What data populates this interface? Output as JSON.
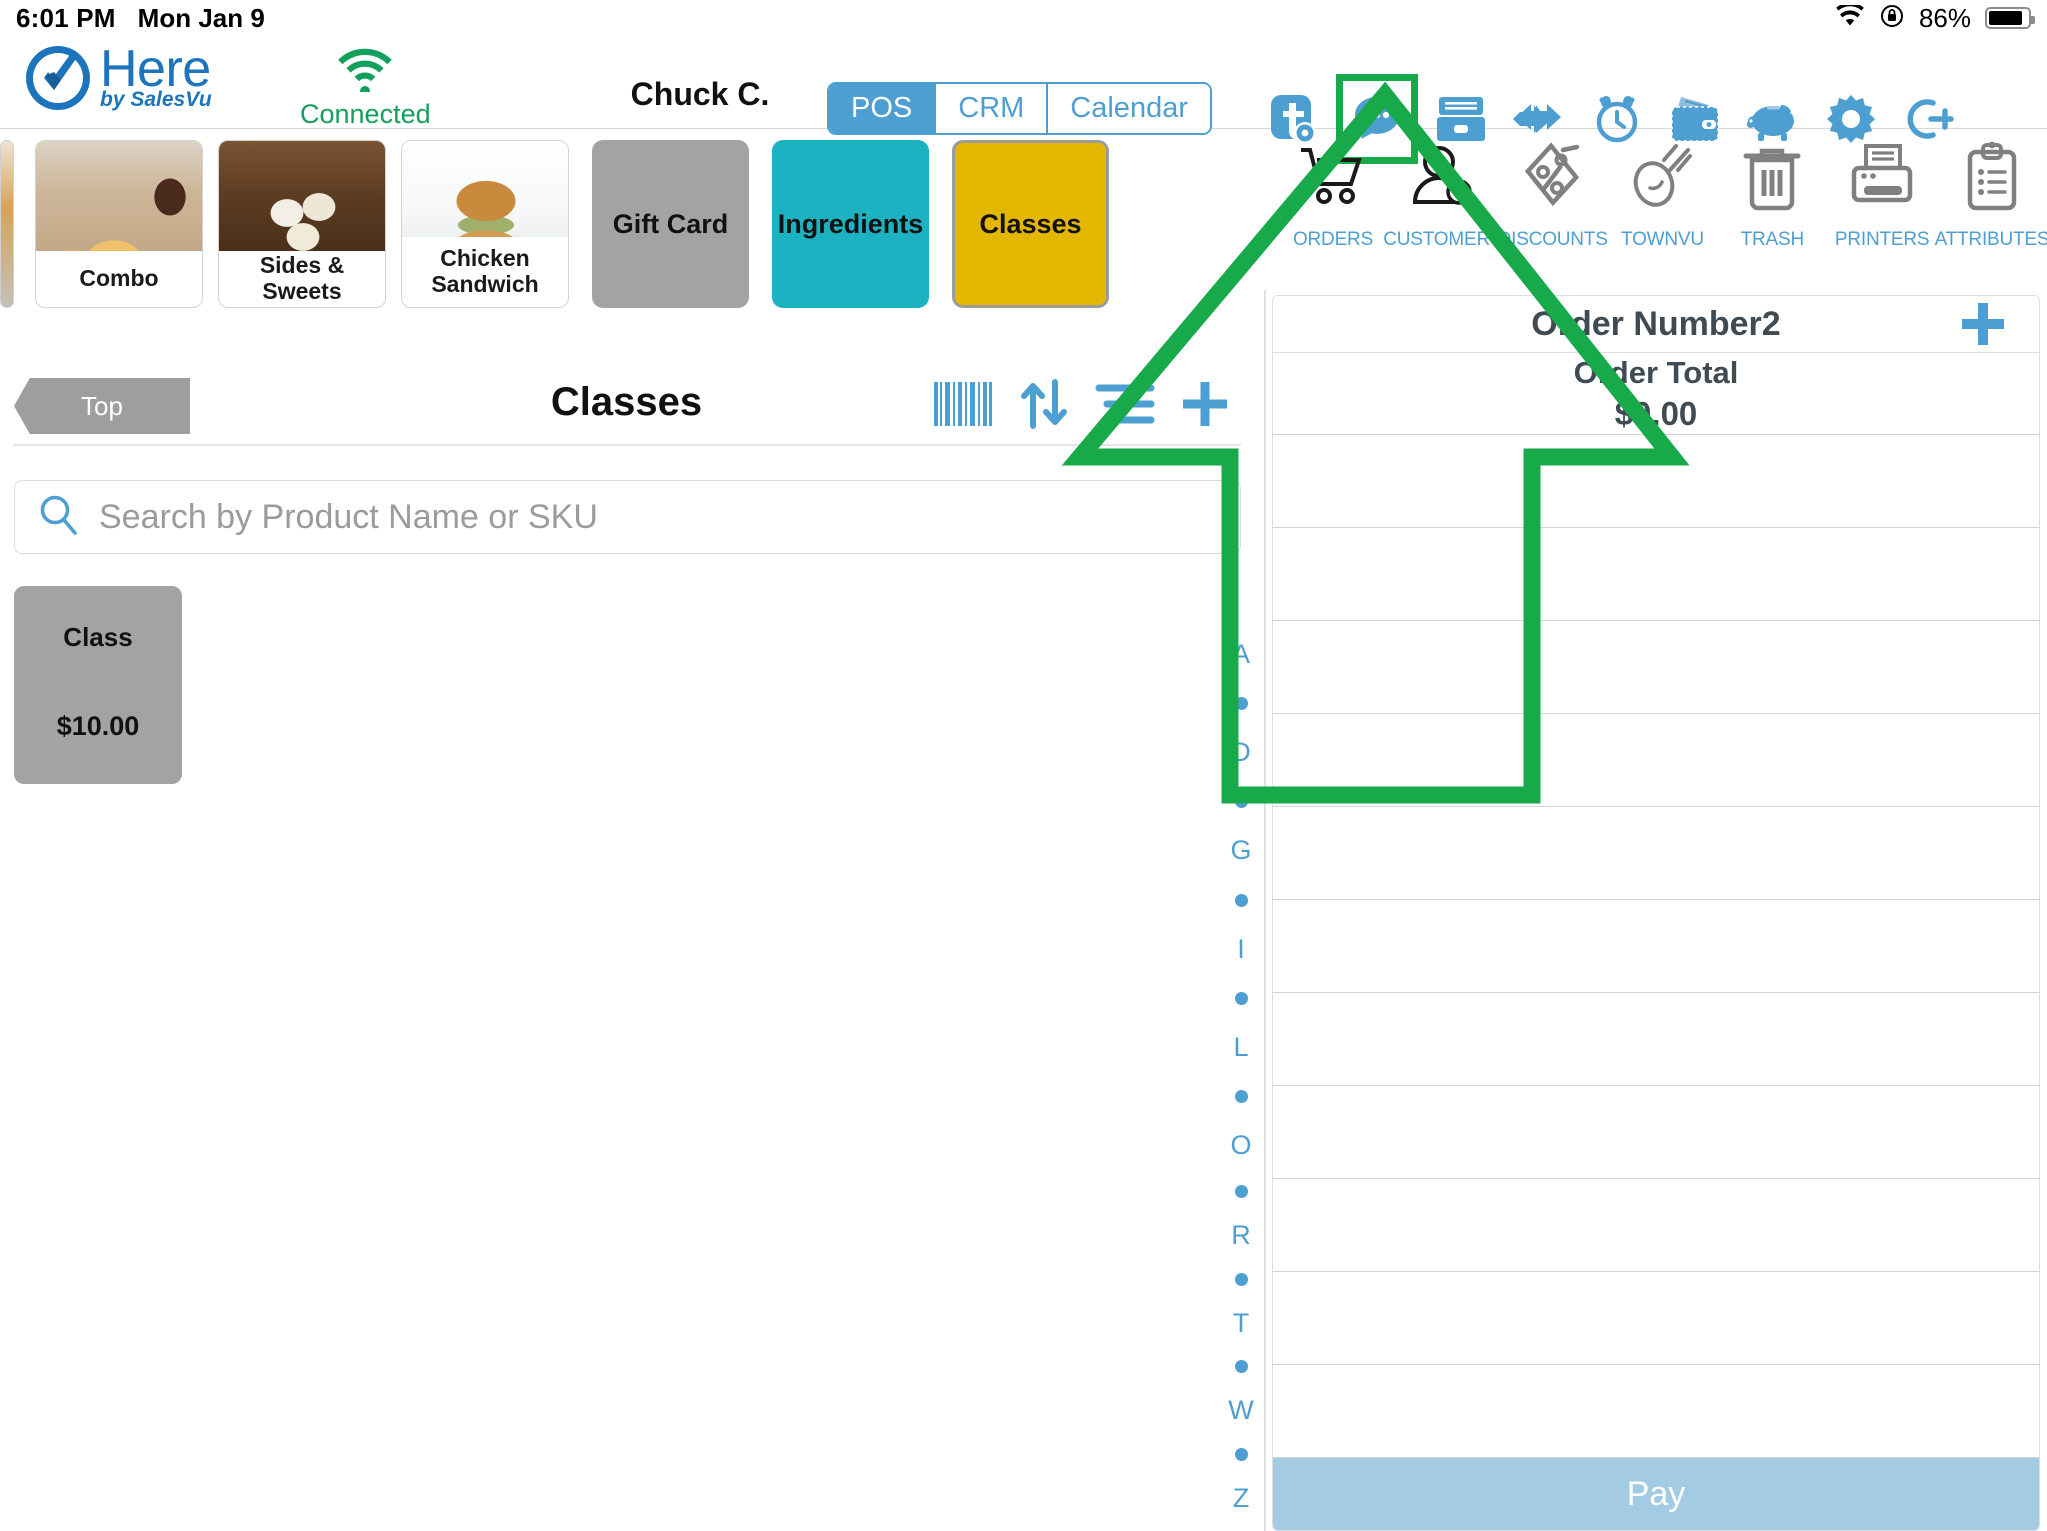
{
  "status_bar": {
    "time": "6:01 PM",
    "date": "Mon Jan 9",
    "wifi_icon": "wifi-icon",
    "orientation_lock_icon": "rotation-lock-icon",
    "battery_percent": "86%",
    "battery_icon": "battery-icon"
  },
  "header": {
    "logo_name": "Here",
    "logo_tagline": "by SalesVu",
    "logo_icon": "here-checkmark-logo",
    "connection": {
      "icon": "wifi-signal-icon",
      "label": "Connected",
      "color": "#13a05c"
    },
    "user_name": "Chuck C.",
    "segments": [
      {
        "label": "POS",
        "active": true
      },
      {
        "label": "CRM",
        "active": false
      },
      {
        "label": "Calendar",
        "active": false
      }
    ],
    "tool_icons": [
      {
        "name": "townvu-settings-icon",
        "highlighted": false
      },
      {
        "name": "chat-messages-icon",
        "highlighted": true
      },
      {
        "name": "cash-drawer-icon",
        "highlighted": false
      },
      {
        "name": "transfer-exchange-icon",
        "highlighted": false
      },
      {
        "name": "time-clock-icon",
        "highlighted": false
      },
      {
        "name": "wallet-icon",
        "highlighted": false
      },
      {
        "name": "piggy-bank-icon",
        "highlighted": false
      },
      {
        "name": "settings-gear-icon",
        "highlighted": false
      },
      {
        "name": "logout-icon",
        "highlighted": false
      }
    ]
  },
  "categories": [
    {
      "label": "Combo",
      "type": "photo",
      "image": "combo-meal-photo"
    },
    {
      "label": "Sides & Sweets",
      "type": "photo",
      "image": "sides-sweets-photo"
    },
    {
      "label": "Chicken Sandwich",
      "type": "photo",
      "image": "chicken-sandwich-photo"
    },
    {
      "label": "Gift Card",
      "type": "solid",
      "color": "#a3a3a3"
    },
    {
      "label": "Ingredients",
      "type": "solid",
      "color": "#1cb2c2"
    },
    {
      "label": "Classes",
      "type": "solid",
      "color": "#e3b600",
      "selected": true
    }
  ],
  "right_strip": [
    {
      "label": "ORDERS",
      "icon": "shopping-cart-icon"
    },
    {
      "label": "CUSTOMERS",
      "icon": "customer-add-icon"
    },
    {
      "label": "DISCOUNTS",
      "icon": "discount-tag-icon"
    },
    {
      "label": "TOWNVU",
      "icon": "townvu-comet-icon"
    },
    {
      "label": "TRASH",
      "icon": "trash-can-icon"
    },
    {
      "label": "PRINTERS",
      "icon": "printer-icon"
    },
    {
      "label": "ATTRIBUTES",
      "icon": "clipboard-attributes-icon"
    }
  ],
  "catalog": {
    "back_button": "Top",
    "title": "Classes",
    "header_icons": [
      {
        "name": "barcode-scan-icon"
      },
      {
        "name": "sort-arrows-icon"
      },
      {
        "name": "filter-list-icon"
      },
      {
        "name": "add-plus-icon"
      }
    ],
    "search": {
      "icon": "search-icon",
      "placeholder": "Search by Product Name or SKU",
      "value": ""
    },
    "products": [
      {
        "name": "Class",
        "price": "$10.00"
      }
    ]
  },
  "alpha_index": [
    "A",
    "•",
    "D",
    "•",
    "G",
    "•",
    "I",
    "•",
    "L",
    "•",
    "O",
    "•",
    "R",
    "•",
    "T",
    "•",
    "W",
    "•",
    "Z"
  ],
  "order_panel": {
    "order_number": "Order Number2",
    "add_order_icon": "add-plus-icon",
    "total_label": "Order Total",
    "total_value": "$0.00",
    "line_items": [],
    "empty_rows": 10,
    "pay_button": "Pay"
  },
  "annotation": {
    "shape": "up-arrow",
    "color": "#18a94b",
    "points_to": "chat-messages-icon"
  },
  "colors": {
    "accent_blue": "#4e9fd1",
    "classes_yellow": "#e3b600",
    "ingredients_teal": "#1cb2c2",
    "gift_gray": "#a3a3a3",
    "pay_blue": "#a3cbe3",
    "annotation_green": "#18a94b",
    "connected_green": "#13a05c"
  }
}
